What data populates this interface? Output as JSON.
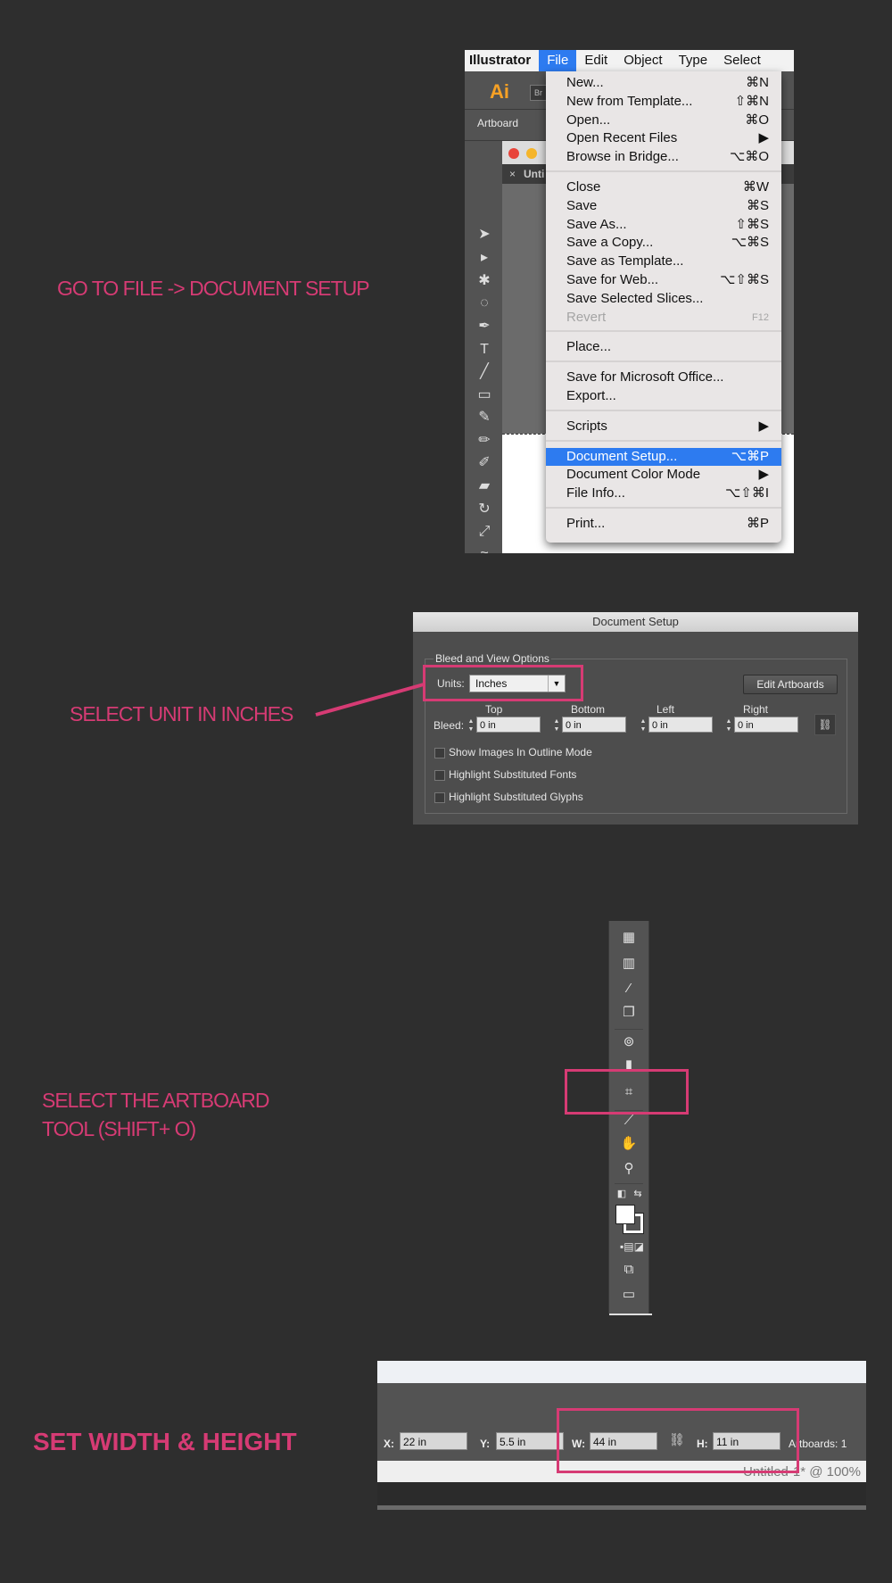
{
  "steps": {
    "step1": "GO TO FILE -> DOCUMENT SETUP",
    "step2": "SELECT UNIT IN INCHES",
    "step3_line1": "SELECT THE ARTBOARD",
    "step3_line2": "TOOL (SHIFT+ O)",
    "step4": "SET WIDTH & HEIGHT"
  },
  "colors": {
    "accent": "#d63b74",
    "menu_highlight": "#2d7bf0",
    "ai_logo": "#f7a125"
  },
  "illustrator": {
    "menubar": [
      "Illustrator",
      "File",
      "Edit",
      "Object",
      "Type",
      "Select"
    ],
    "active_menu": "File",
    "logo_text": "Ai",
    "bridge_text": "Br",
    "control_label": "Artboard",
    "doc_tab": "Unti",
    "doc_tab_close": "×",
    "file_menu": {
      "items": [
        {
          "label": "New...",
          "shortcut": "⌘N"
        },
        {
          "label": "New from Template...",
          "shortcut": "⇧⌘N"
        },
        {
          "label": "Open...",
          "shortcut": "⌘O"
        },
        {
          "label": "Open Recent Files",
          "shortcut": "▶"
        },
        {
          "label": "Browse in Bridge...",
          "shortcut": "⌥⌘O"
        },
        {
          "label": "Close",
          "shortcut": "⌘W"
        },
        {
          "label": "Save",
          "shortcut": "⌘S"
        },
        {
          "label": "Save As...",
          "shortcut": "⇧⌘S"
        },
        {
          "label": "Save a Copy...",
          "shortcut": "⌥⌘S"
        },
        {
          "label": "Save as Template...",
          "shortcut": ""
        },
        {
          "label": "Save for Web...",
          "shortcut": "⌥⇧⌘S"
        },
        {
          "label": "Save Selected Slices...",
          "shortcut": ""
        },
        {
          "label": "Revert",
          "shortcut": "F12"
        },
        {
          "label": "Place...",
          "shortcut": ""
        },
        {
          "label": "Save for Microsoft Office...",
          "shortcut": ""
        },
        {
          "label": "Export...",
          "shortcut": ""
        },
        {
          "label": "Scripts",
          "shortcut": "▶"
        },
        {
          "label": "Document Setup...",
          "shortcut": "⌥⌘P"
        },
        {
          "label": "Document Color Mode",
          "shortcut": "▶"
        },
        {
          "label": "File Info...",
          "shortcut": "⌥⇧⌘I"
        },
        {
          "label": "Print...",
          "shortcut": "⌘P"
        }
      ],
      "highlighted": "Document Setup...",
      "disabled": "Revert"
    }
  },
  "document_setup": {
    "title": "Document Setup",
    "group_label": "Bleed and View Options",
    "units_label": "Units:",
    "units_value": "Inches",
    "edit_artboards": "Edit Artboards",
    "bleed_label": "Bleed:",
    "bleed": [
      {
        "label": "Top",
        "value": "0 in"
      },
      {
        "label": "Bottom",
        "value": "0 in"
      },
      {
        "label": "Left",
        "value": "0 in"
      },
      {
        "label": "Right",
        "value": "0 in"
      }
    ],
    "options": [
      {
        "label": "Show Images In Outline Mode",
        "checked": false
      },
      {
        "label": "Highlight Substituted Fonts",
        "checked": false
      },
      {
        "label": "Highlight Substituted Glyphs",
        "checked": false
      }
    ]
  },
  "transform": {
    "x_label": "X:",
    "x_value": "22 in",
    "y_label": "Y:",
    "y_value": "5.5 in",
    "w_label": "W:",
    "w_value": "44 in",
    "h_label": "H:",
    "h_value": "11 in",
    "artboards": "Artboards: 1",
    "status": "Untitled-1* @ 100%"
  }
}
